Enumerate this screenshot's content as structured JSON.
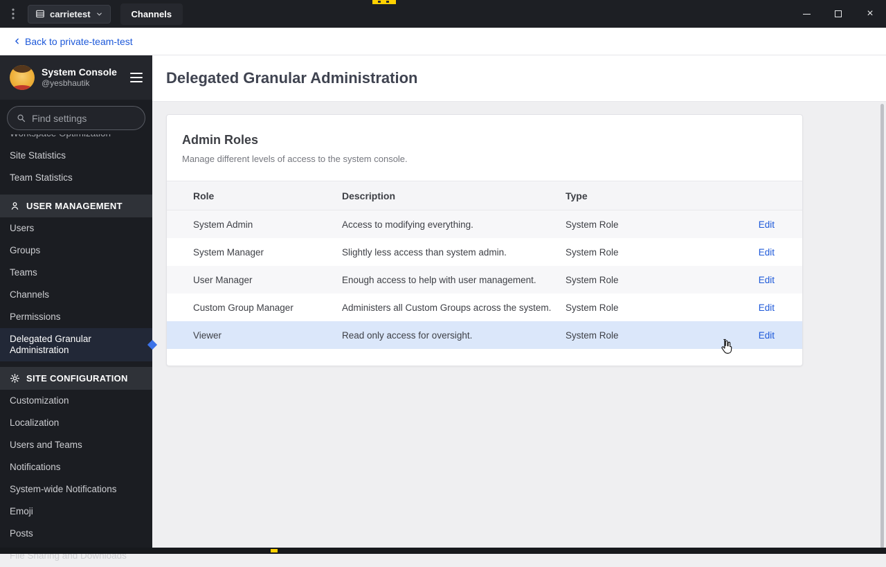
{
  "titlebar": {
    "server_name": "carrietest",
    "tab_label": "Channels",
    "close_glyph": "×",
    "window_controls": [
      "minimize-icon",
      "maximize-icon",
      "close-icon"
    ]
  },
  "backbar": {
    "label": "Back to private-team-test"
  },
  "sidebar": {
    "title": "System Console",
    "subtitle": "@yesbhautik",
    "search_placeholder": "Find settings",
    "top_items": [
      "Workspace Optimization",
      "Site Statistics",
      "Team Statistics"
    ],
    "sections": [
      {
        "label": "USER MANAGEMENT",
        "icon": "users-icon",
        "selected": "Delegated Granular Administration",
        "items": [
          "Users",
          "Groups",
          "Teams",
          "Channels",
          "Permissions",
          "Delegated Granular Administration"
        ]
      },
      {
        "label": "SITE CONFIGURATION",
        "icon": "gear-icon",
        "items": [
          "Customization",
          "Localization",
          "Users and Teams",
          "Notifications",
          "System-wide Notifications",
          "Emoji",
          "Posts",
          "File Sharing and Downloads"
        ]
      }
    ]
  },
  "main": {
    "page_title": "Delegated Granular Administration",
    "card": {
      "title": "Admin Roles",
      "subtitle": "Manage different levels of access to the system console.",
      "table": {
        "headers": [
          "Role",
          "Description",
          "Type"
        ],
        "action_label": "Edit",
        "rows": [
          {
            "role": "System Admin",
            "description": "Access to modifying everything.",
            "type": "System Role"
          },
          {
            "role": "System Manager",
            "description": "Slightly less access than system admin.",
            "type": "System Role"
          },
          {
            "role": "User Manager",
            "description": "Enough access to help with user management.",
            "type": "System Role"
          },
          {
            "role": "Custom Group Manager",
            "description": "Administers all Custom Groups across the system.",
            "type": "System Role"
          },
          {
            "role": "Viewer",
            "description": "Read only access for oversight.",
            "type": "System Role",
            "highlighted": true
          }
        ]
      }
    }
  },
  "colors": {
    "accent_blue": "#1c58d9",
    "titlebar_bg": "#1d1f24",
    "sidebar_bg": "#1b1d22",
    "row_highlight": "#dbe7fa",
    "selected_indicator": "#3b72e8",
    "peek_yellow": "#ffd100"
  }
}
